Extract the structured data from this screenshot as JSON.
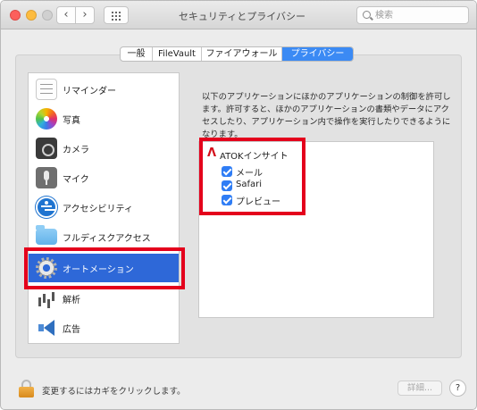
{
  "window": {
    "title": "セキュリティとプライバシー",
    "search_placeholder": "検索",
    "back_glyph": "‹",
    "forward_glyph": "›"
  },
  "tabs": [
    {
      "label": "一般",
      "active": false
    },
    {
      "label": "FileVault",
      "active": false
    },
    {
      "label": "ファイアウォール",
      "active": false
    },
    {
      "label": "プライバシー",
      "active": true
    }
  ],
  "sidebar": {
    "items": [
      {
        "label": "リマインダー",
        "icon": "reminders-icon",
        "selected": false
      },
      {
        "label": "写真",
        "icon": "photos-icon",
        "selected": false
      },
      {
        "label": "カメラ",
        "icon": "camera-icon",
        "selected": false
      },
      {
        "label": "マイク",
        "icon": "microphone-icon",
        "selected": false
      },
      {
        "label": "アクセシビリティ",
        "icon": "accessibility-icon",
        "selected": false
      },
      {
        "label": "フルディスクアクセス",
        "icon": "folder-icon",
        "selected": false
      },
      {
        "label": "オートメーション",
        "icon": "automation-gear-icon",
        "selected": true
      },
      {
        "label": "解析",
        "icon": "analytics-icon",
        "selected": false
      },
      {
        "label": "広告",
        "icon": "advertising-icon",
        "selected": false
      }
    ]
  },
  "panel": {
    "description": "以下のアプリケーションにほかのアプリケーションの制御を許可します。許可すると、ほかのアプリケーションの書類やデータにアクセスしたり、アプリケーション内で操作を実行したりできるようになります。",
    "app": {
      "name": "ATOKインサイト",
      "icon": "atok-icon",
      "permissions": [
        {
          "label": "メール",
          "checked": true
        },
        {
          "label": "Safari",
          "checked": true
        },
        {
          "label": "プレビュー",
          "checked": true
        }
      ]
    }
  },
  "footer": {
    "lock_text": "変更するにはカギをクリックします。",
    "details_label": "詳細...",
    "help_label": "?"
  },
  "colors": {
    "accent": "#3b8af4",
    "selection": "#2e68d8",
    "highlight_box": "#e4001c"
  }
}
